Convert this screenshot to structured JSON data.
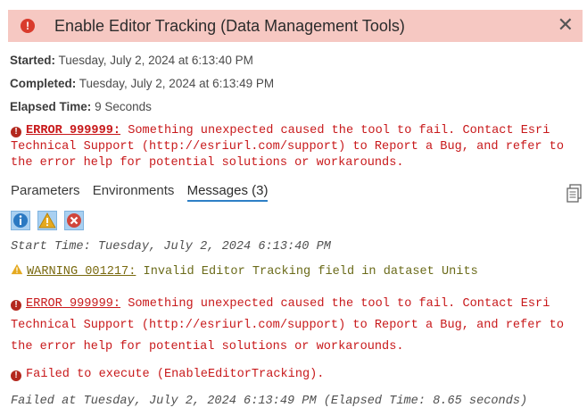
{
  "dialog": {
    "title": "Enable Editor Tracking (Data Management Tools)",
    "close_label": "✕"
  },
  "summary": {
    "started_label": "Started:",
    "started_value": "Tuesday, July 2, 2024 at 6:13:40 PM",
    "completed_label": "Completed:",
    "completed_value": "Tuesday, July 2, 2024 at 6:13:49 PM",
    "elapsed_label": "Elapsed Time:",
    "elapsed_value": "9 Seconds"
  },
  "top_error": {
    "code": "ERROR 999999:",
    "line1": " Something unexpected caused the tool to fail. Contact Esri",
    "line2": "Technical Support (http://esriurl.com/support) to Report a Bug, and refer to",
    "line3": "the error help for potential solutions or workarounds."
  },
  "tabs": [
    "Parameters",
    "Environments",
    "Messages (3)"
  ],
  "messages": {
    "start": "Start Time: Tuesday, July 2, 2024 6:13:40 PM",
    "warning_code": "WARNING 001217:",
    "warning_text": " Invalid Editor Tracking field in dataset Units",
    "error_code": "ERROR 999999:",
    "error_line1": " Something unexpected caused the tool to fail. Contact Esri",
    "error_line2": "Technical Support (http://esriurl.com/support) to Report a Bug, and refer to",
    "error_line3": "the error help for potential solutions or workarounds.",
    "failed_exec": "Failed to execute (EnableEditorTracking).",
    "failed_at": "Failed at Tuesday, July 2, 2024 6:13:49 PM (Elapsed Time: 8.65 seconds)"
  },
  "colors": {
    "header_bg": "#f6c8c2",
    "error_red": "#c8191b",
    "tab_underline": "#2d7fc6"
  }
}
